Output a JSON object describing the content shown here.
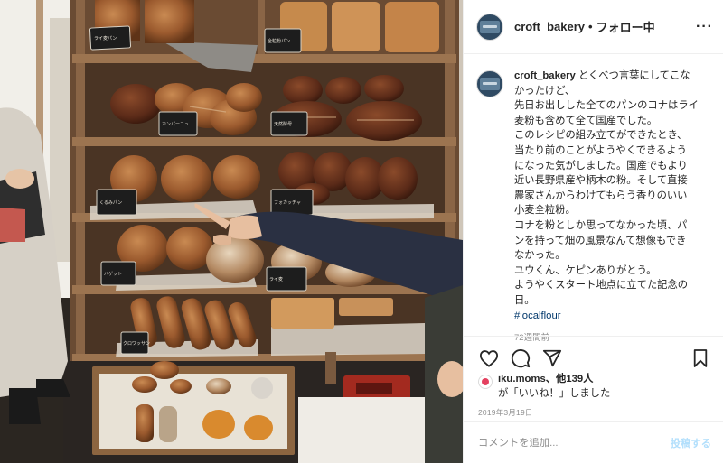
{
  "post": {
    "username": "croft_bakery",
    "dot": "•",
    "follow_status": "フォロー中",
    "more": "···"
  },
  "caption": {
    "username": "croft_bakery",
    "lines": [
      "とくべつ言葉にしてこな",
      "かったけど、",
      "先日お出しした全てのパンのコナはライ",
      "麦粉も含めて全て国産でした。",
      "このレシピの組み立てができたとき、",
      "当たり前のことがようやくできるよう",
      "になった気がしました。国産でもより",
      "近い長野県産や柄木の粉。そして直接",
      "農家さんからわけてもらう香りのいい",
      "小麦全粒粉。",
      "コナを粉としか思ってなかった頃、パ",
      "ンを持って畑の風景なんて想像もでき",
      "なかった。",
      "ユウくん、ケピンありがとう。",
      "ようやくスタート地点に立てた記念の",
      "日。"
    ],
    "hashtag": "#localflour",
    "time_ago": "72週間前"
  },
  "actions": {
    "icons": [
      "heart-icon",
      "comment-icon",
      "share-icon",
      "bookmark-icon"
    ],
    "liked_by_user": "iku.moms",
    "liked_by_rest": "、他139人",
    "liked_by_suffix": "が「いいね！」しました",
    "date": "2019年3月19日"
  },
  "comment": {
    "placeholder": "コメントを追加...",
    "post_label": "投稿する"
  },
  "photo": {
    "shelf_labels": [
      "ライ麦パン",
      "全粒粉パン",
      "カンパーニュ",
      "天然酵母",
      "くるみパン",
      "フォカッチャ",
      "バゲット",
      "ライ麦",
      "クロワッサン"
    ]
  },
  "colors": {
    "link": "#00376b",
    "post_button": "#b2dffc",
    "secondary_text": "#8e8e8e"
  }
}
